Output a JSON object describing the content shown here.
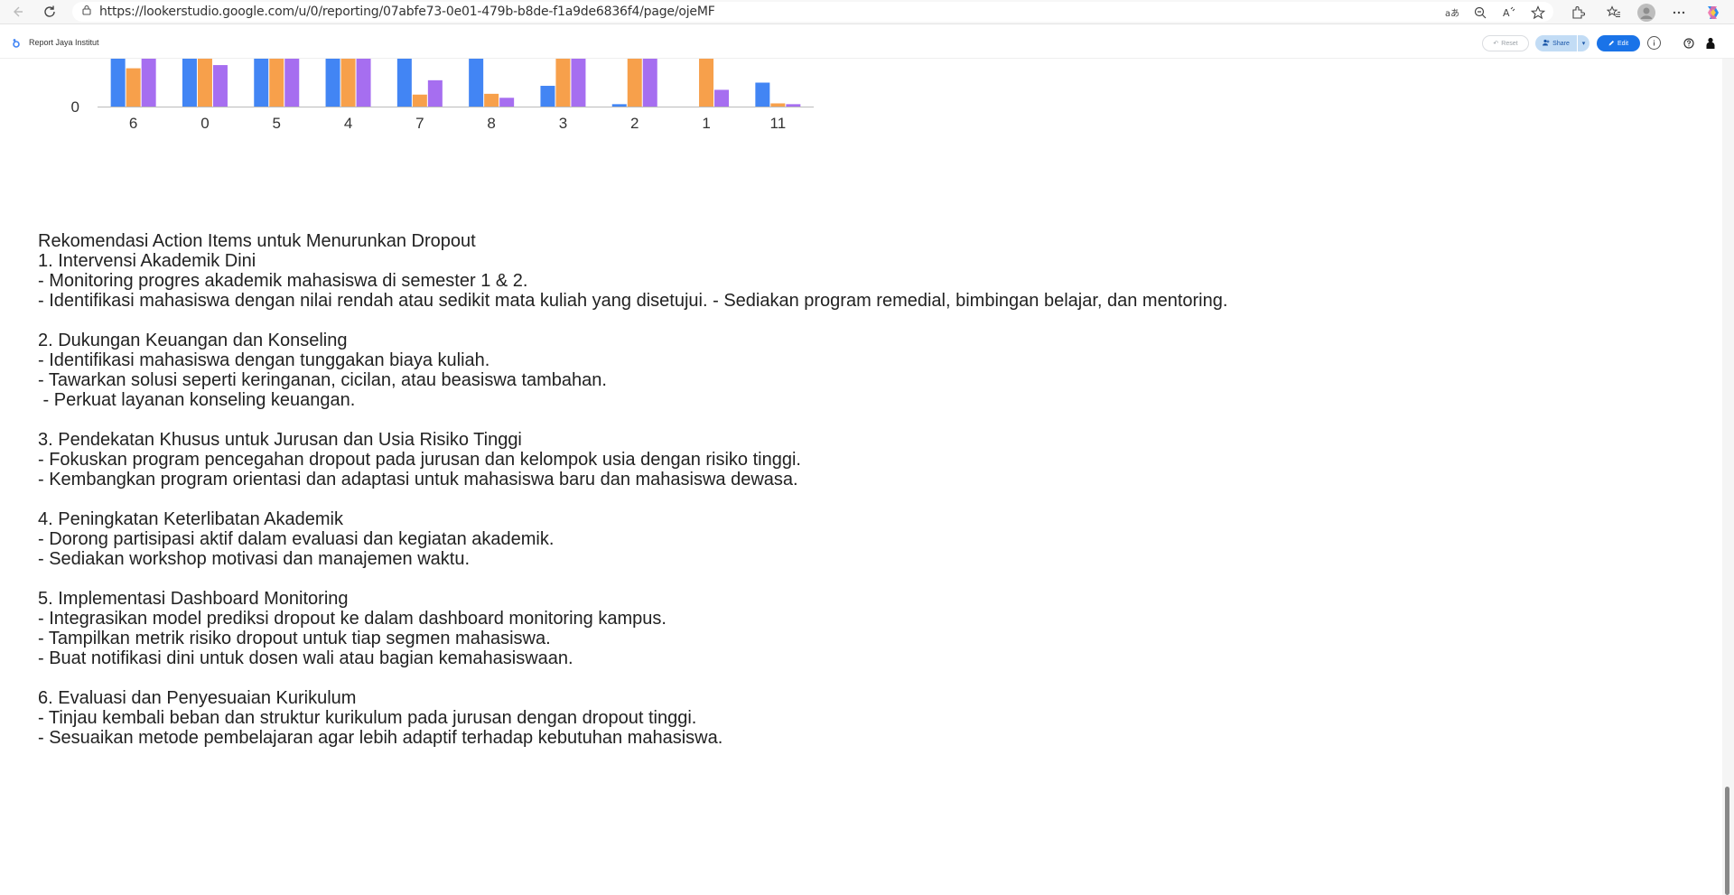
{
  "browser": {
    "url": "https://lookerstudio.google.com/u/0/reporting/07abfe73-0e01-479b-b8de-f1a9de6836f4/page/ojeMF"
  },
  "app": {
    "report_title": "Report Jaya Institut",
    "reset_label": "Reset",
    "share_label": "Share",
    "edit_label": "Edit"
  },
  "chart_data": {
    "type": "bar",
    "categories": [
      "6",
      "0",
      "5",
      "4",
      "7",
      "8",
      "3",
      "2",
      "1",
      "11"
    ],
    "y_tick_labels": [
      "0"
    ],
    "series": [
      {
        "color": "#4285f4",
        "values": [
          60,
          60,
          60,
          60,
          60,
          60,
          26,
          3,
          0,
          30
        ]
      },
      {
        "color": "#f7a04b",
        "values": [
          48,
          60,
          60,
          60,
          15,
          16,
          60,
          60,
          60,
          4
        ]
      },
      {
        "color": "#a66ef0",
        "values": [
          60,
          52,
          60,
          60,
          33,
          11,
          60,
          60,
          21,
          3
        ]
      }
    ],
    "ylim_visible": [
      0,
      60
    ],
    "colors": {
      "blue": "#4285f4",
      "orange": "#f7a04b",
      "purple": "#a66ef0"
    }
  },
  "recommendations": {
    "lines": [
      "Rekomendasi Action Items untuk Menurunkan Dropout",
      "1. Intervensi Akademik Dini",
      "- Monitoring progres akademik mahasiswa di semester 1 & 2.",
      "- Identifikasi mahasiswa dengan nilai rendah atau sedikit mata kuliah yang disetujui. - Sediakan program remedial, bimbingan belajar, dan mentoring.",
      "",
      "2. Dukungan Keuangan dan Konseling",
      "- Identifikasi mahasiswa dengan tunggakan biaya kuliah.",
      "- Tawarkan solusi seperti keringanan, cicilan, atau beasiswa tambahan.",
      " - Perkuat layanan konseling keuangan.",
      "",
      "3. Pendekatan Khusus untuk Jurusan dan Usia Risiko Tinggi",
      "- Fokuskan program pencegahan dropout pada jurusan dan kelompok usia dengan risiko tinggi.",
      "- Kembangkan program orientasi dan adaptasi untuk mahasiswa baru dan mahasiswa dewasa.",
      "",
      "4. Peningkatan Keterlibatan Akademik",
      "- Dorong partisipasi aktif dalam evaluasi dan kegiatan akademik.",
      "- Sediakan workshop motivasi dan manajemen waktu.",
      "",
      "5. Implementasi Dashboard Monitoring",
      "- Integrasikan model prediksi dropout ke dalam dashboard monitoring kampus.",
      "- Tampilkan metrik risiko dropout untuk tiap segmen mahasiswa.",
      "- Buat notifikasi dini untuk dosen wali atau bagian kemahasiswaan.",
      "",
      "6. Evaluasi dan Penyesuaian Kurikulum",
      "- Tinjau kembali beban dan struktur kurikulum pada jurusan dengan dropout tinggi.",
      "- Sesuaikan metode pembelajaran agar lebih adaptif terhadap kebutuhan mahasiswa."
    ]
  }
}
